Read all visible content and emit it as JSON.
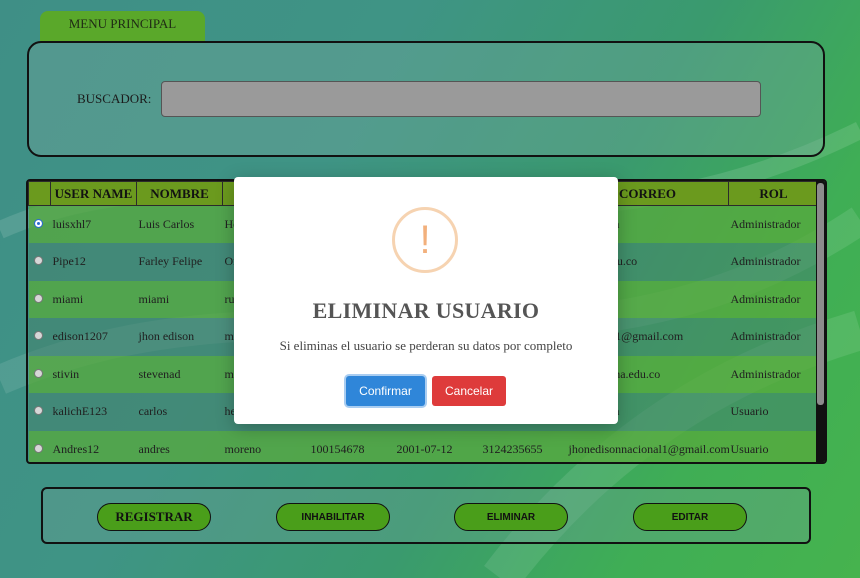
{
  "nav": {
    "menu_tab": "MENU PRINCIPAL"
  },
  "search": {
    "label": "BUSCADOR:",
    "value": "",
    "placeholder": ""
  },
  "table": {
    "headers": [
      "",
      "USER NAME",
      "NOMBRE",
      "",
      "",
      "",
      "",
      "CORREO",
      "ROL"
    ],
    "rows": [
      {
        "selected": true,
        "cells": [
          "luisxhl7",
          "Luis Carlos",
          "He",
          "",
          "",
          "",
          "gmail.com",
          "Administrador"
        ]
      },
      {
        "selected": false,
        "cells": [
          "Pipe12",
          "Farley Felipe",
          "Or",
          "",
          "",
          "",
          "misena.edu.co",
          "Administrador"
        ]
      },
      {
        "selected": false,
        "cells": [
          "miami",
          "miami",
          "ru",
          "",
          "",
          "",
          "mail.com",
          "Administrador"
        ]
      },
      {
        "selected": false,
        "cells": [
          "edison1207",
          "jhon edison",
          "mo",
          "",
          "",
          "",
          "nnacional1@gmail.com",
          "Administrador"
        ]
      },
      {
        "selected": false,
        "cells": [
          "stivin",
          "stevenad",
          "mo",
          "",
          "",
          "",
          "o3@misena.edu.co",
          "Administrador"
        ]
      },
      {
        "selected": false,
        "cells": [
          "kalichE123",
          "carlos",
          "he",
          "",
          "",
          "",
          "gmail.com",
          "Usuario"
        ]
      },
      {
        "selected": false,
        "cells": [
          "Andres12",
          "andres",
          "moreno",
          "100154678",
          "2001-07-12",
          "3124235655",
          "jhonedisonnacional1@gmail.com",
          "Usuario"
        ]
      }
    ]
  },
  "actions": {
    "register": "REGISTRAR",
    "disable": "INHABILITAR",
    "delete": "ELIMINAR",
    "edit": "EDITAR"
  },
  "modal": {
    "icon": "!",
    "title": "ELIMINAR USUARIO",
    "text": "Si eliminas el usuario se perderan su datos por completo",
    "confirm": "Confirmar",
    "cancel": "Cancelar"
  },
  "colors": {
    "green_button": "#4a9e1a",
    "confirm": "#2f86d9",
    "cancel": "#de3b3b",
    "header": "#6b9a1e"
  }
}
